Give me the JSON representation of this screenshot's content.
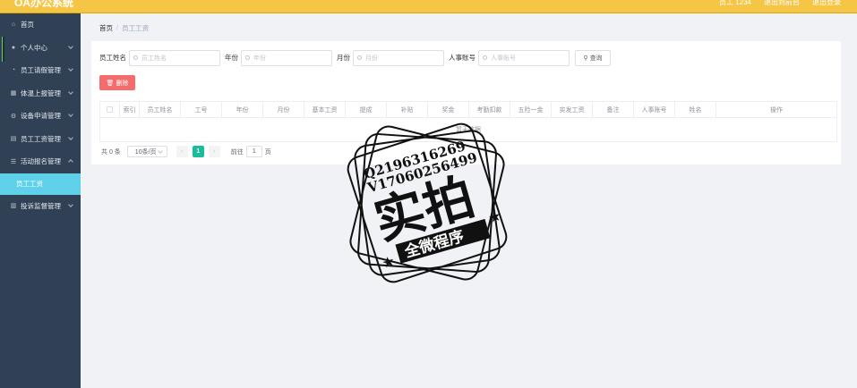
{
  "app": {
    "title": "OA办公系统"
  },
  "topbar": {
    "user_label": "员工 1234",
    "home_link": "退出到前台",
    "logout": "退出登录"
  },
  "sidebar": {
    "items": [
      {
        "label": "首页",
        "icon": "home-icon"
      },
      {
        "label": "个人中心",
        "icon": "user-icon"
      },
      {
        "label": "员工请假管理",
        "icon": "bell-icon"
      },
      {
        "label": "体温上报管理",
        "icon": "grid-icon"
      },
      {
        "label": "设备申请管理",
        "icon": "gear-icon"
      },
      {
        "label": "员工工资管理",
        "icon": "doc-icon"
      },
      {
        "label": "活动报名管理",
        "icon": "menu-icon"
      },
      {
        "label": "员工工资"
      },
      {
        "label": "投诉监督管理",
        "icon": "chart-icon"
      }
    ]
  },
  "breadcrumb": {
    "home": "首页",
    "separator": "/",
    "current": "员工工资"
  },
  "search": {
    "name_label": "员工姓名",
    "name_placeholder": "员工姓名",
    "year_label": "年份",
    "year_placeholder": "年份",
    "month_label": "月份",
    "month_placeholder": "月份",
    "account_label": "人事账号",
    "account_placeholder": "人事账号",
    "query_label": "查询"
  },
  "toolbar": {
    "delete_label": "删除"
  },
  "table": {
    "columns": [
      "索引",
      "员工姓名",
      "工号",
      "年份",
      "月份",
      "基本工资",
      "提成",
      "补贴",
      "奖金",
      "考勤扣款",
      "五险一金",
      "实发工资",
      "备注",
      "人事账号",
      "姓名",
      "操作"
    ],
    "empty_text": "暂无数据"
  },
  "pagination": {
    "total_text": "共 0 条",
    "page_size": "10条/页",
    "current_page": "1",
    "goto_label": "前往",
    "goto_value": "1",
    "page_unit": "页"
  },
  "watermark": {
    "line1": "Q2196316269",
    "line2": "V17060256499",
    "main": "实拍",
    "banner": "全微程序"
  }
}
